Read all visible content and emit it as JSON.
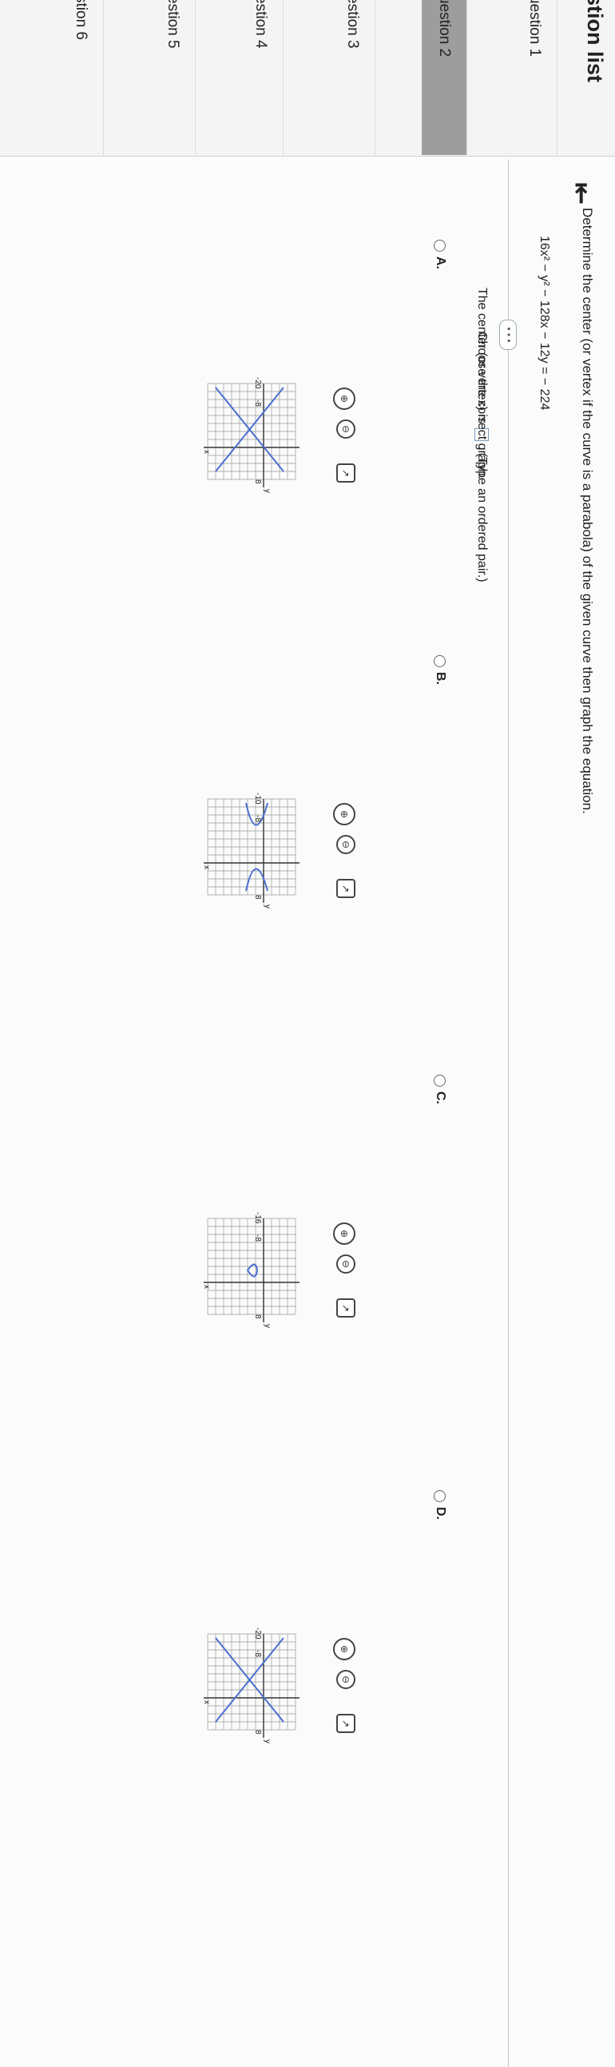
{
  "sidebar": {
    "title": "stion list",
    "items": [
      {
        "label": "uestion 1",
        "state": "normal"
      },
      {
        "label": "uestion 2",
        "state": "active"
      },
      {
        "label": "estion 3",
        "state": "normal"
      },
      {
        "label": "estion 4",
        "state": "normal"
      },
      {
        "label": "estion 5",
        "state": "normal"
      },
      {
        "label": "stion 6",
        "state": "normal"
      }
    ]
  },
  "main": {
    "collapse_icon": "collapse-left-icon",
    "instruction": "Determine the center (or vertex if the curve is a parabola) of the given curve then graph the equation.",
    "equation": "16x² − y² − 128x − 12y = − 224",
    "more_label": "• • •",
    "center_prefix": "The center (or vertex) is",
    "center_suffix": ". (Type an ordered pair.)",
    "choose_label": "Choose the correct graph."
  },
  "choices": [
    {
      "letter": "A.",
      "y_label": "8",
      "x_label": "x",
      "axis_labels": [
        "y",
        "-8"
      ],
      "bottom_label": "-20"
    },
    {
      "letter": "B.",
      "y_label": "8",
      "x_label": "x",
      "axis_labels": [
        "y",
        "-8"
      ],
      "bottom_label": "-10"
    },
    {
      "letter": "C.",
      "y_label": "8",
      "x_label": "x",
      "axis_labels": [
        "y",
        "-8"
      ],
      "bottom_label": "-16"
    },
    {
      "letter": "D.",
      "y_label": "8",
      "x_label": "x",
      "axis_labels": [
        "y",
        "-8"
      ],
      "bottom_label": "-20"
    }
  ],
  "colors": {
    "curve": "#4a6fd1",
    "sidebar_active": "#9d9d9d",
    "accent_box": "#7a9cbb"
  }
}
